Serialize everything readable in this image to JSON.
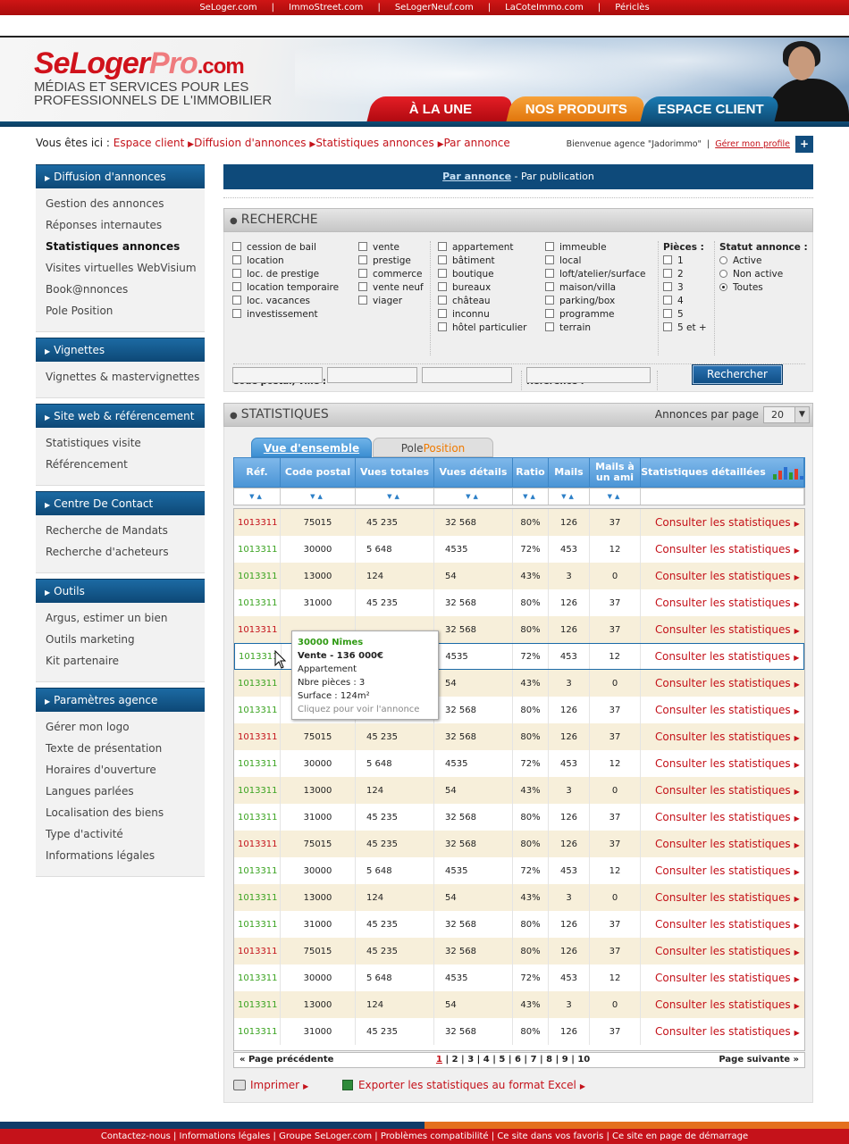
{
  "topbar": {
    "links": [
      "SeLoger.com",
      "ImmoStreet.com",
      "SeLogerNeuf.com",
      "LaCoteImmo.com",
      "Périclès"
    ]
  },
  "header": {
    "logo": {
      "se": "SeLoger",
      "pro": "Pro",
      "com": ".com"
    },
    "tagline_1": "MÉDIAS ET SERVICES POUR LES",
    "tagline_2": "PROFESSIONNELS DE L'IMMOBILIER",
    "nav": [
      "À LA UNE",
      "NOS PRODUITS",
      "ESPACE CLIENT"
    ]
  },
  "breadcrumb": {
    "prefix": "Vous êtes ici :",
    "items": [
      "Espace client",
      "Diffusion d'annonces",
      "Statistiques annonces",
      "Par annonce"
    ]
  },
  "welcome": {
    "text": "Bienvenue agence \"Jadorimmo\"",
    "link": "Gérer mon profile",
    "plus": "+"
  },
  "sidebar": [
    {
      "title": "Diffusion d'annonces",
      "items": [
        "Gestion des annonces",
        "Réponses internautes",
        "Statistiques annonces",
        "Visites virtuelles WebVisium",
        "Book@nnonces",
        "Pole Position"
      ]
    },
    {
      "title": "Vignettes",
      "items": [
        "Vignettes & mastervignettes"
      ]
    },
    {
      "title": "Site web & référencement",
      "items": [
        "Statistiques visite",
        "Référencement"
      ]
    },
    {
      "title": "Centre De Contact",
      "items": [
        "Recherche de Mandats",
        "Recherche d'acheteurs"
      ]
    },
    {
      "title": "Outils",
      "items": [
        "Argus, estimer un bien",
        "Outils marketing",
        "Kit partenaire"
      ]
    },
    {
      "title": "Paramètres agence",
      "items": [
        "Gérer mon logo",
        "Texte de présentation",
        "Horaires d'ouverture",
        "Langues parlées",
        "Localisation des biens",
        "Type d'activité",
        "Informations légales"
      ]
    }
  ],
  "view_tabs": {
    "active": "Par annonce",
    "sep": " - ",
    "other": "Par publication"
  },
  "search": {
    "title": "RECHERCHE",
    "col1": [
      "cession de bail",
      "location",
      "loc. de prestige",
      "location temporaire",
      "loc. vacances",
      "investissement"
    ],
    "col2": [
      "vente",
      "prestige",
      "commerce",
      "vente neuf",
      "viager"
    ],
    "col3": [
      "appartement",
      "bâtiment",
      "boutique",
      "bureaux",
      "château",
      "inconnu",
      "hôtel particulier"
    ],
    "col4": [
      "immeuble",
      "local",
      "loft/atelier/surface",
      "maison/villa",
      "parking/box",
      "programme",
      "terrain"
    ],
    "pieces_title": "Pièces :",
    "pieces": [
      "1",
      "2",
      "3",
      "4",
      "5",
      "5 et +"
    ],
    "statut_title": "Statut annonce :",
    "statut": [
      "Active",
      "Non active",
      "Toutes"
    ],
    "cp_label": "Code postal, ville :",
    "ref_label": "Référence :",
    "button": "Rechercher"
  },
  "stats": {
    "title": "STATISTIQUES",
    "per_page_label": "Annonces par page",
    "per_page": "20",
    "tab_active": "Vue d'ensemble",
    "tab_other_a": "Pole",
    "tab_other_b": "Position",
    "headers": [
      "Réf.",
      "Code postal",
      "Vues totales",
      "Vues détails",
      "Ratio",
      "Mails",
      "Mails à un ami",
      "Statistiques détaillées"
    ],
    "consult_label": "Consulter les statistiques",
    "rows": [
      {
        "ref": "1013311",
        "cp": "75015",
        "vt": "45 235",
        "vd": "32 568",
        "ratio": "80%",
        "mails": "126",
        "ami": "37",
        "ref_color": "red"
      },
      {
        "ref": "1013311",
        "cp": "30000",
        "vt": "5 648",
        "vd": "4535",
        "ratio": "72%",
        "mails": "453",
        "ami": "12",
        "ref_color": "green"
      },
      {
        "ref": "1013311",
        "cp": "13000",
        "vt": "124",
        "vd": "54",
        "ratio": "43%",
        "mails": "3",
        "ami": "0",
        "ref_color": "green"
      },
      {
        "ref": "1013311",
        "cp": "31000",
        "vt": "45 235",
        "vd": "32 568",
        "ratio": "80%",
        "mails": "126",
        "ami": "37",
        "ref_color": "green"
      },
      {
        "ref": "1013311",
        "cp": "",
        "vt": "",
        "vd": "32 568",
        "ratio": "80%",
        "mails": "126",
        "ami": "37",
        "ref_color": "red"
      },
      {
        "ref": "1013311",
        "cp": "",
        "vt": "",
        "vd": "4535",
        "ratio": "72%",
        "mails": "453",
        "ami": "12",
        "ref_color": "green"
      },
      {
        "ref": "1013311",
        "cp": "",
        "vt": "",
        "vd": "54",
        "ratio": "43%",
        "mails": "3",
        "ami": "0",
        "ref_color": "green"
      },
      {
        "ref": "1013311",
        "cp": "",
        "vt": "",
        "vd": "32 568",
        "ratio": "80%",
        "mails": "126",
        "ami": "37",
        "ref_color": "green"
      },
      {
        "ref": "1013311",
        "cp": "75015",
        "vt": "45 235",
        "vd": "32 568",
        "ratio": "80%",
        "mails": "126",
        "ami": "37",
        "ref_color": "red"
      },
      {
        "ref": "1013311",
        "cp": "30000",
        "vt": "5 648",
        "vd": "4535",
        "ratio": "72%",
        "mails": "453",
        "ami": "12",
        "ref_color": "green"
      },
      {
        "ref": "1013311",
        "cp": "13000",
        "vt": "124",
        "vd": "54",
        "ratio": "43%",
        "mails": "3",
        "ami": "0",
        "ref_color": "green"
      },
      {
        "ref": "1013311",
        "cp": "31000",
        "vt": "45 235",
        "vd": "32 568",
        "ratio": "80%",
        "mails": "126",
        "ami": "37",
        "ref_color": "green"
      },
      {
        "ref": "1013311",
        "cp": "75015",
        "vt": "45 235",
        "vd": "32 568",
        "ratio": "80%",
        "mails": "126",
        "ami": "37",
        "ref_color": "red"
      },
      {
        "ref": "1013311",
        "cp": "30000",
        "vt": "5 648",
        "vd": "4535",
        "ratio": "72%",
        "mails": "453",
        "ami": "12",
        "ref_color": "green"
      },
      {
        "ref": "1013311",
        "cp": "13000",
        "vt": "124",
        "vd": "54",
        "ratio": "43%",
        "mails": "3",
        "ami": "0",
        "ref_color": "green"
      },
      {
        "ref": "1013311",
        "cp": "31000",
        "vt": "45 235",
        "vd": "32 568",
        "ratio": "80%",
        "mails": "126",
        "ami": "37",
        "ref_color": "green"
      },
      {
        "ref": "1013311",
        "cp": "75015",
        "vt": "45 235",
        "vd": "32 568",
        "ratio": "80%",
        "mails": "126",
        "ami": "37",
        "ref_color": "red"
      },
      {
        "ref": "1013311",
        "cp": "30000",
        "vt": "5 648",
        "vd": "4535",
        "ratio": "72%",
        "mails": "453",
        "ami": "12",
        "ref_color": "green"
      },
      {
        "ref": "1013311",
        "cp": "13000",
        "vt": "124",
        "vd": "54",
        "ratio": "43%",
        "mails": "3",
        "ami": "0",
        "ref_color": "green"
      },
      {
        "ref": "1013311",
        "cp": "31000",
        "vt": "45 235",
        "vd": "32 568",
        "ratio": "80%",
        "mails": "126",
        "ami": "37",
        "ref_color": "green"
      }
    ],
    "tooltip": [
      "30000 Nîmes",
      "Vente - 136 000€",
      "Appartement",
      "Nbre pièces : 3",
      "Surface : 124m²",
      "Cliquez pour voir l'annonce"
    ],
    "pager": {
      "prev": "« Page précédente",
      "next": "Page suivante »",
      "pages": [
        "1",
        "2",
        "3",
        "4",
        "5",
        "6",
        "7",
        "8",
        "9",
        "10"
      ],
      "current": "1"
    },
    "print": "Imprimer",
    "export": "Exporter les statistiques au format Excel"
  },
  "footer": {
    "links": [
      "Contactez-nous",
      "Informations légales",
      "Groupe SeLoger.com",
      "Problèmes compatibilité",
      "Ce site dans vos favoris",
      "Ce site en page de démarrage"
    ]
  },
  "colors": {
    "brand_red": "#c4121a",
    "nav_blue": "#0e4a7a",
    "row_odd": "#f7efda",
    "ref_green": "#3aa320"
  }
}
